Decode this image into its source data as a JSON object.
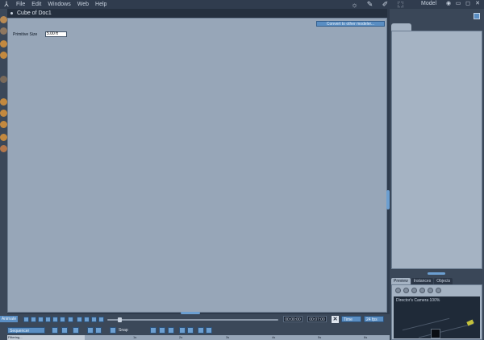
{
  "menubar": {
    "items": [
      "File",
      "Edit",
      "Windows",
      "Web",
      "Help"
    ],
    "room_label": "Model"
  },
  "document": {
    "title": "Cube of Doc1",
    "convert_button": "Convert to other modeler...",
    "primitive_size_label": "Primitive Size",
    "primitive_size_value": "5.00 ft"
  },
  "right_panel": {
    "tabs": [
      "Preview",
      "Instances",
      "Objects"
    ],
    "camera_label": "Director's Camera 100%"
  },
  "animation": {
    "label": "Animate",
    "current_time": "00:00:00",
    "end_time": "00:07:00",
    "time_mode": "Time",
    "fps": "24 fps",
    "sequencer": "Sequencer",
    "snap_label": "Snap",
    "track_label": "Filtering...",
    "ticks": [
      "1s",
      "2s",
      "3s",
      "4s",
      "5s",
      "6s"
    ]
  },
  "colors": {
    "accent": "#5a8ec3",
    "workspace": "#97a6b8",
    "chrome": "#303c4e"
  }
}
